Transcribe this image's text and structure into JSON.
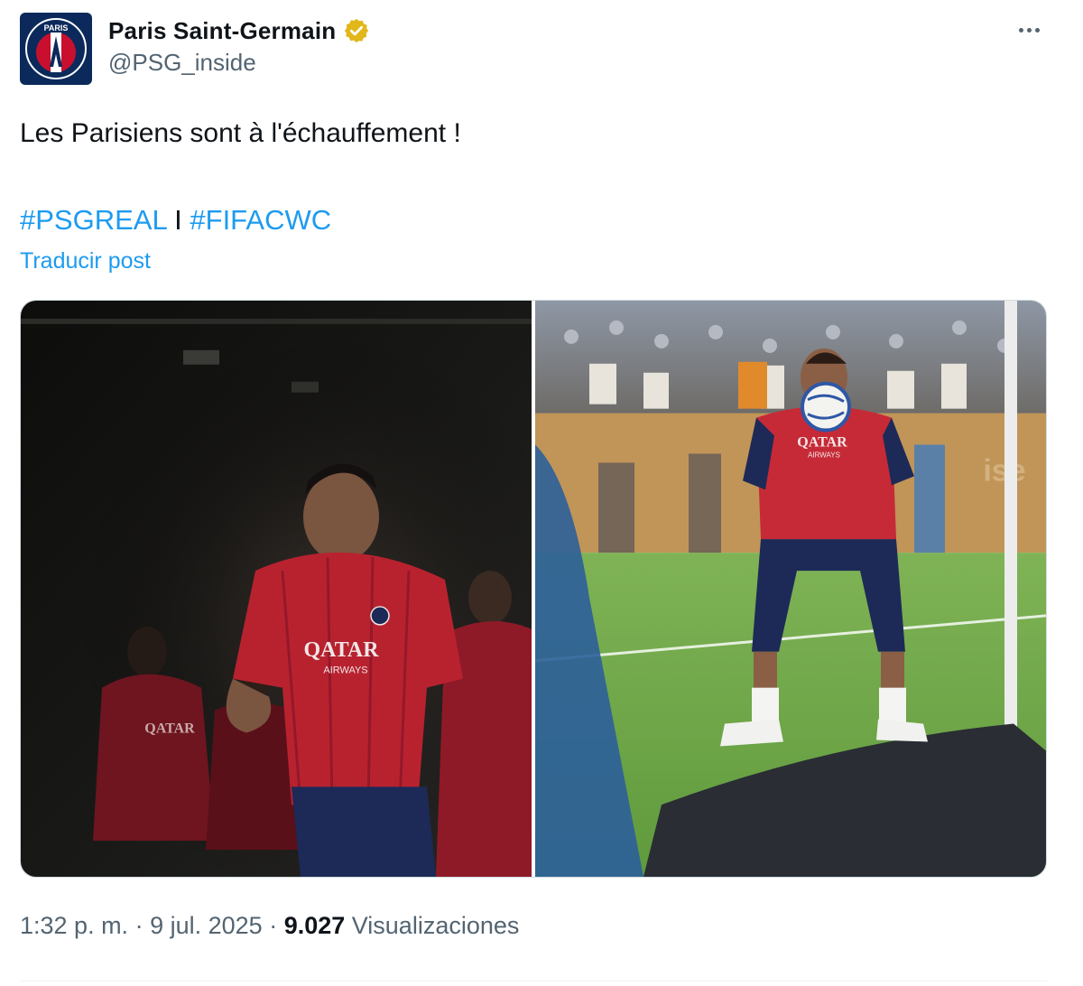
{
  "author": {
    "display_name": "Paris Saint-Germain",
    "handle": "@PSG_inside",
    "avatar_logo_text": "PARIS",
    "verified_icon": "gold-verified-badge-icon"
  },
  "post": {
    "text": "Les Parisiens sont à l'échauffement !",
    "hashtag_1": "#PSGREAL",
    "separator": " I ",
    "hashtag_2": "#FIFACWC",
    "translate_label": "Traducir post"
  },
  "media": {
    "left_photo_icon": "photo-player-tunnel",
    "right_photo_icon": "photo-goalkeeper-warmup",
    "left_shirt_text_line1": "QATAR",
    "left_shirt_text_line2": "AIRWAYS",
    "right_shirt_text_line1": "QATAR",
    "right_shirt_text_line2": "AIRWAYS"
  },
  "meta": {
    "time": "1:32 p. m.",
    "dot1": " · ",
    "date": "9 jul. 2025",
    "dot2": " · ",
    "views_count": "9.027",
    "views_label": " Visualizaciones"
  },
  "colors": {
    "link": "#1d9bf0",
    "secondary_text": "#536471",
    "primary_text": "#0f1419",
    "verified_gold": "#e2b719",
    "psg_navy": "#0b2a5b"
  }
}
